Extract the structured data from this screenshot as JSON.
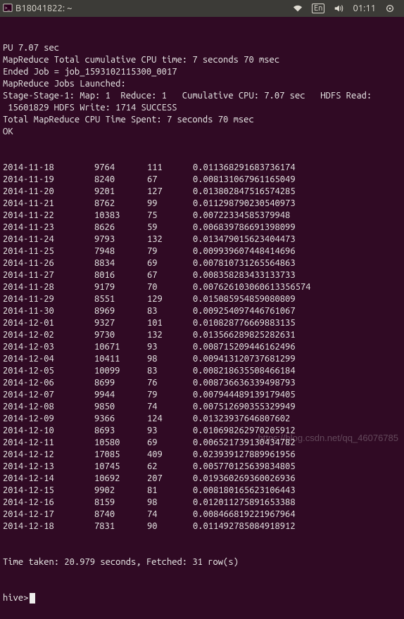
{
  "menubar": {
    "title_icon": "terminal-icon",
    "title": "B18041822: ~"
  },
  "tray": {
    "ime": "En",
    "clock": "01:11"
  },
  "terminal": {
    "header_lines": [
      "PU 7.07 sec",
      "MapReduce Total cumulative CPU time: 7 seconds 70 msec",
      "Ended Job = job_1593102115300_0017",
      "MapReduce Jobs Launched:",
      "Stage-Stage-1: Map: 1  Reduce: 1   Cumulative CPU: 7.07 sec   HDFS Read:",
      " 15601829 HDFS Write: 1714 SUCCESS",
      "Total MapReduce CPU Time Spent: 7 seconds 70 msec",
      "OK"
    ],
    "rows": [
      {
        "date": "2014-11-18",
        "a": "9764",
        "b": "111",
        "c": "0.011368291683736174"
      },
      {
        "date": "2014-11-19",
        "a": "8240",
        "b": "67",
        "c": "0.008131067961165049"
      },
      {
        "date": "2014-11-20",
        "a": "9201",
        "b": "127",
        "c": "0.013802847516574285"
      },
      {
        "date": "2014-11-21",
        "a": "8762",
        "b": "99",
        "c": "0.011298790230540973"
      },
      {
        "date": "2014-11-22",
        "a": "10383",
        "b": "75",
        "c": "0.00722334585379948"
      },
      {
        "date": "2014-11-23",
        "a": "8626",
        "b": "59",
        "c": "0.006839786691398099"
      },
      {
        "date": "2014-11-24",
        "a": "9793",
        "b": "132",
        "c": "0.013479015623404473"
      },
      {
        "date": "2014-11-25",
        "a": "7948",
        "b": "79",
        "c": "0.009939607448414696"
      },
      {
        "date": "2014-11-26",
        "a": "8834",
        "b": "69",
        "c": "0.007810731265564863"
      },
      {
        "date": "2014-11-27",
        "a": "8016",
        "b": "67",
        "c": "0.008358283433133733"
      },
      {
        "date": "2014-11-28",
        "a": "9179",
        "b": "70",
        "c": "0.007626103060613356574"
      },
      {
        "date": "2014-11-29",
        "a": "8551",
        "b": "129",
        "c": "0.015085954859080809"
      },
      {
        "date": "2014-11-30",
        "a": "8969",
        "b": "83",
        "c": "0.009254097446761067"
      },
      {
        "date": "2014-12-01",
        "a": "9327",
        "b": "101",
        "c": "0.010828776669883135"
      },
      {
        "date": "2014-12-02",
        "a": "9730",
        "b": "132",
        "c": "0.013566289825282631"
      },
      {
        "date": "2014-12-03",
        "a": "10671",
        "b": "93",
        "c": "0.008715209446162496"
      },
      {
        "date": "2014-12-04",
        "a": "10411",
        "b": "98",
        "c": "0.009413120737681299"
      },
      {
        "date": "2014-12-05",
        "a": "10099",
        "b": "83",
        "c": "0.008218635508466184"
      },
      {
        "date": "2014-12-06",
        "a": "8699",
        "b": "76",
        "c": "0.008736636339498793"
      },
      {
        "date": "2014-12-07",
        "a": "9944",
        "b": "79",
        "c": "0.007944489139179405"
      },
      {
        "date": "2014-12-08",
        "a": "9850",
        "b": "74",
        "c": "0.007512690355329949"
      },
      {
        "date": "2014-12-09",
        "a": "9366",
        "b": "124",
        "c": "0.01323937646807602"
      },
      {
        "date": "2014-12-10",
        "a": "8693",
        "b": "93",
        "c": "0.010698262970205912"
      },
      {
        "date": "2014-12-11",
        "a": "10580",
        "b": "69",
        "c": "0.006521739130434782"
      },
      {
        "date": "2014-12-12",
        "a": "17085",
        "b": "409",
        "c": "0.023939127889961956"
      },
      {
        "date": "2014-12-13",
        "a": "10745",
        "b": "62",
        "c": "0.005770125639834805"
      },
      {
        "date": "2014-12-14",
        "a": "10692",
        "b": "207",
        "c": "0.019360269360026936"
      },
      {
        "date": "2014-12-15",
        "a": "9902",
        "b": "81",
        "c": "0.008180165623106443"
      },
      {
        "date": "2014-12-16",
        "a": "8159",
        "b": "98",
        "c": "0.012011275891653388"
      },
      {
        "date": "2014-12-17",
        "a": "8740",
        "b": "74",
        "c": "0.008466819221967964"
      },
      {
        "date": "2014-12-18",
        "a": "7831",
        "b": "90",
        "c": "0.011492785084918912"
      }
    ],
    "footer": "Time taken: 20.979 seconds, Fetched: 31 row(s)",
    "prompt": "hive>"
  },
  "watermark": "https://blog.csdn.net/qq_46076785"
}
